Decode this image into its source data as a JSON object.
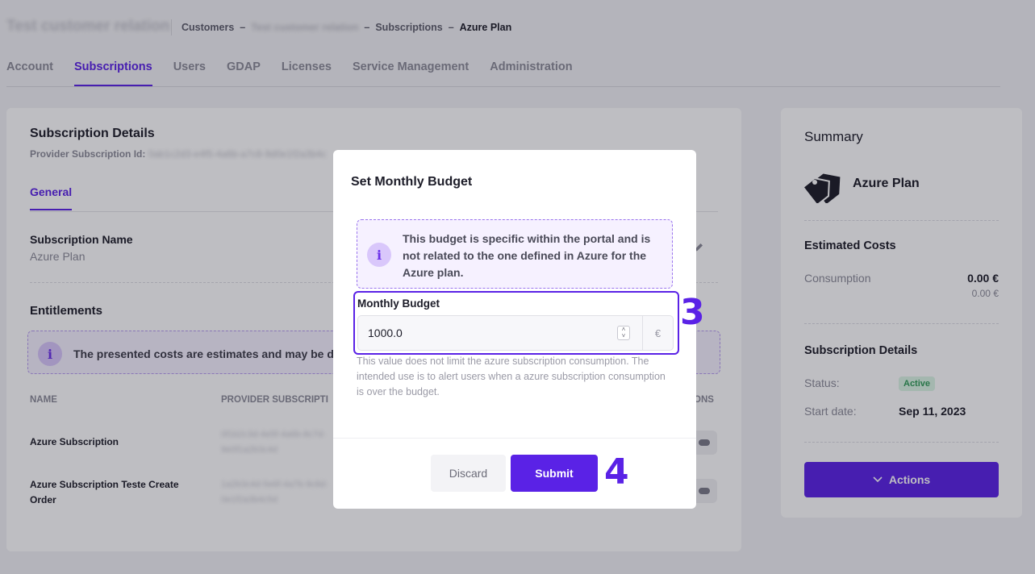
{
  "header": {
    "app_title": "Test customer relation",
    "breadcrumb": {
      "customers": "Customers",
      "separator": "–",
      "customer_name": "Test customer relation",
      "subscriptions": "Subscriptions",
      "current": "Azure Plan"
    }
  },
  "tabs": [
    {
      "label": "Account",
      "active": false
    },
    {
      "label": "Subscriptions",
      "active": true
    },
    {
      "label": "Users",
      "active": false
    },
    {
      "label": "GDAP",
      "active": false
    },
    {
      "label": "Licenses",
      "active": false
    },
    {
      "label": "Service Management",
      "active": false
    },
    {
      "label": "Administration",
      "active": false
    }
  ],
  "subscription_details": {
    "title": "Subscription Details",
    "provider_id_label": "Provider Subscription Id:",
    "provider_id_value": "0ab1c2d3-e4f5-4a6b-a7c8-9d0e1f2a3b4c",
    "inner_tab": "General",
    "name_label": "Subscription Name",
    "name_value": "Azure Plan",
    "entitlements_title": "Entitlements",
    "entitlements_info": "The presented costs are estimates and may be d",
    "table": {
      "headers": {
        "name": "NAME",
        "provider": "PROVIDER SUBSCRIPTI",
        "actions": "ONS"
      },
      "rows": [
        {
          "name": "Azure Subscription",
          "provider": "0f1b2c3d-4e5f-4a6b-8c7d-9e0f1a2b3c4d"
        },
        {
          "name": "Azure Subscription Teste Create Order",
          "provider": "1a2b3c4d-5e6f-4a7b-9c8d-0e1f2a3b4c5d"
        }
      ]
    }
  },
  "summary": {
    "title": "Summary",
    "plan_icon": "tag-icon",
    "plan_name": "Azure Plan",
    "estimated_costs_title": "Estimated Costs",
    "consumption_label": "Consumption",
    "consumption_value": "0.00 €",
    "consumption_sub": "0.00 €",
    "details_title": "Subscription Details",
    "status_label": "Status:",
    "status_value": "Active",
    "start_date_label": "Start date:",
    "start_date_value": "Sep 11, 2023",
    "actions_label": "Actions",
    "actions_icon": "chevron-down-icon"
  },
  "modal": {
    "title": "Set Monthly Budget",
    "info_icon": "info-icon",
    "info_text": "This budget is specific within the portal and is not related to the one defined in Azure for the Azure plan.",
    "budget_label": "Monthly Budget",
    "budget_value": "1000.0",
    "currency": "€",
    "helper_text": "This value does not limit the azure subscription consumption. The intended use is to alert users when a azure subscription consumption is over the budget.",
    "discard_label": "Discard",
    "submit_label": "Submit"
  },
  "annotations": {
    "step3": "3",
    "step4": "4"
  },
  "colors": {
    "accent": "#5a22e6",
    "status_active": "#2e9b57",
    "overlay": "rgba(20,20,35,0.28)"
  }
}
